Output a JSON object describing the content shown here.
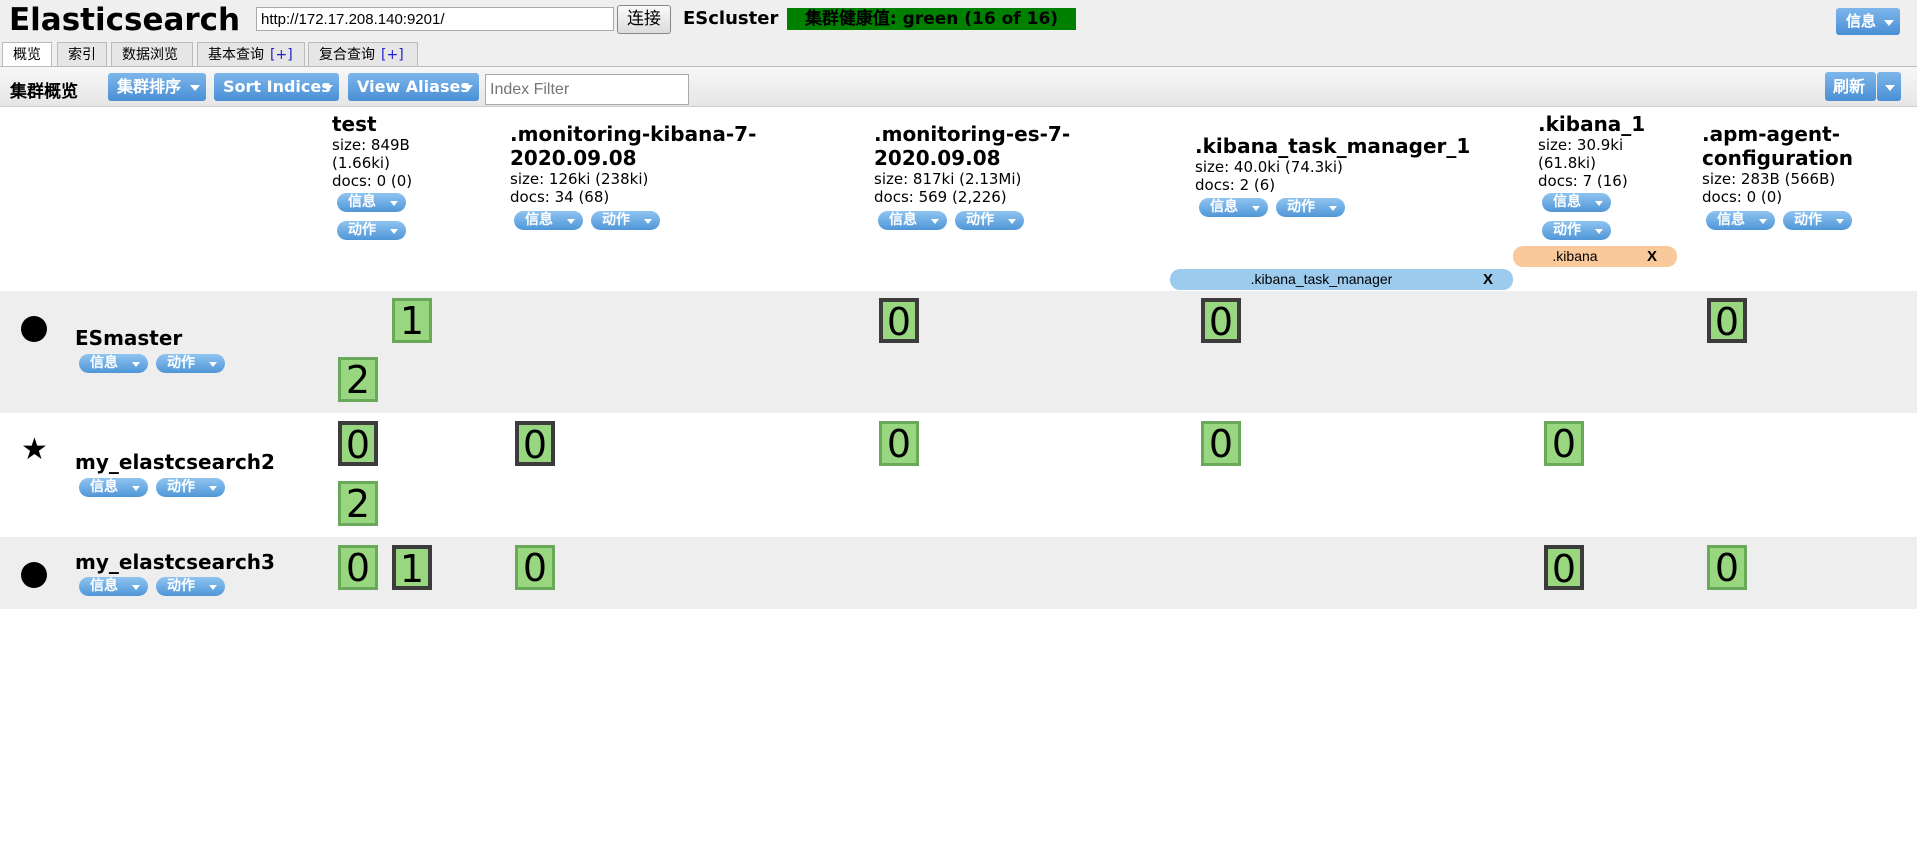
{
  "header": {
    "title": "Elasticsearch",
    "url_value": "http://172.17.208.140:9201/",
    "connect_label": "连接",
    "cluster_name": "EScluster",
    "health_text": "集群健康值: green (16 of 16)",
    "health_color": "#008000",
    "info_label": "信息"
  },
  "tabs": [
    {
      "label": "概览"
    },
    {
      "label": "索引"
    },
    {
      "label": "数据浏览"
    },
    {
      "label": "基本查询",
      "plus": "[+]"
    },
    {
      "label": "复合查询",
      "plus": "[+]"
    }
  ],
  "toolbar": {
    "title": "集群概览",
    "sort_cluster": "集群排序",
    "sort_indices": "Sort Indices",
    "view_aliases": "View Aliases",
    "filter_placeholder": "Index Filter",
    "refresh": "刷新"
  },
  "pill_labels": {
    "info": "信息",
    "action": "动作"
  },
  "indices": [
    {
      "name": "test",
      "size": "size: 849B",
      "size2": "(1.66ki)",
      "docs": "docs: 0 (0)"
    },
    {
      "name": ".monitoring-kibana-7-",
      "name2": "2020.09.08",
      "size": "size: 126ki (238ki)",
      "docs": "docs: 34 (68)"
    },
    {
      "name": ".monitoring-es-7-",
      "name2": "2020.09.08",
      "size": "size: 817ki (2.13Mi)",
      "docs": "docs: 569 (2,226)"
    },
    {
      "name": ".kibana_task_manager_1",
      "size": "size: 40.0ki (74.3ki)",
      "docs": "docs: 2 (6)"
    },
    {
      "name": ".kibana_1",
      "size": "size: 30.9ki",
      "size2": "(61.8ki)",
      "docs": "docs: 7 (16)"
    },
    {
      "name": ".apm-agent-",
      "name2": "configuration",
      "size": "size: 283B (566B)",
      "docs": "docs: 0 (0)"
    }
  ],
  "aliases": [
    {
      "label": ".kibana_task_manager",
      "x": "X",
      "color": "#9ccbee"
    },
    {
      "label": ".kibana",
      "x": "X",
      "color": "#f9c89b"
    }
  ],
  "nodes": [
    {
      "name": "ESmaster",
      "icon": "circle"
    },
    {
      "name": "my_elastcsearch2",
      "icon": "star",
      "star": "★"
    },
    {
      "name": "my_elastcsearch3",
      "icon": "circle"
    }
  ],
  "shards": {
    "esmaster": [
      "1",
      "2",
      "0",
      "0",
      "0"
    ],
    "node2": [
      "0",
      "2",
      "0",
      "0",
      "0",
      "0"
    ],
    "node3": [
      "0",
      "1",
      "0",
      "0",
      "0"
    ]
  }
}
